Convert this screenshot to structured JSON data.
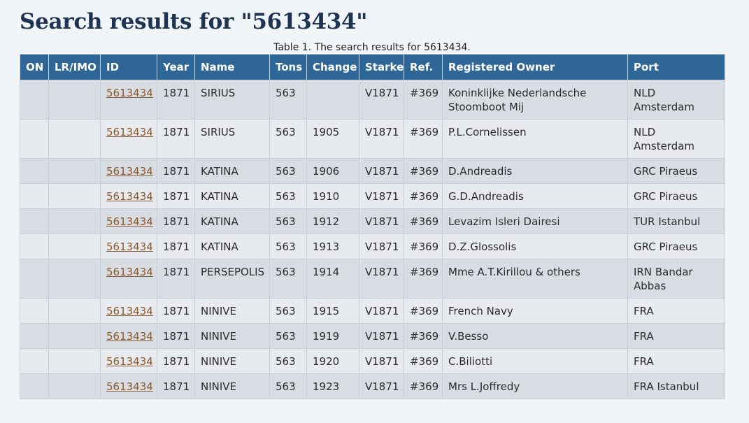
{
  "page": {
    "title": "Search results for \"5613434\"",
    "caption": "Table 1. The search results for 5613434."
  },
  "table": {
    "headers": [
      "ON",
      "LR/IMO",
      "ID",
      "Year",
      "Name",
      "Tons",
      "Change",
      "Starke",
      "Ref.",
      "Registered Owner",
      "Port"
    ],
    "rows": [
      {
        "on": "",
        "lrimo": "",
        "id": "5613434",
        "year": "1871",
        "name": "SIRIUS",
        "tons": "563",
        "change": "",
        "starke": "V1871",
        "ref": "#369",
        "owner": "Koninklijke Nederlandsche Stoomboot Mij",
        "port": "NLD Amsterdam"
      },
      {
        "on": "",
        "lrimo": "",
        "id": "5613434",
        "year": "1871",
        "name": "SIRIUS",
        "tons": "563",
        "change": "1905",
        "starke": "V1871",
        "ref": "#369",
        "owner": "P.L.Cornelissen",
        "port": "NLD Amsterdam"
      },
      {
        "on": "",
        "lrimo": "",
        "id": "5613434",
        "year": "1871",
        "name": "KATINA",
        "tons": "563",
        "change": "1906",
        "starke": "V1871",
        "ref": "#369",
        "owner": "D.Andreadis",
        "port": "GRC Piraeus"
      },
      {
        "on": "",
        "lrimo": "",
        "id": "5613434",
        "year": "1871",
        "name": "KATINA",
        "tons": "563",
        "change": "1910",
        "starke": "V1871",
        "ref": "#369",
        "owner": "G.D.Andreadis",
        "port": "GRC Piraeus"
      },
      {
        "on": "",
        "lrimo": "",
        "id": "5613434",
        "year": "1871",
        "name": "KATINA",
        "tons": "563",
        "change": "1912",
        "starke": "V1871",
        "ref": "#369",
        "owner": "Levazim Isleri Dairesi",
        "port": "TUR Istanbul"
      },
      {
        "on": "",
        "lrimo": "",
        "id": "5613434",
        "year": "1871",
        "name": "KATINA",
        "tons": "563",
        "change": "1913",
        "starke": "V1871",
        "ref": "#369",
        "owner": "D.Z.Glossolis",
        "port": "GRC Piraeus"
      },
      {
        "on": "",
        "lrimo": "",
        "id": "5613434",
        "year": "1871",
        "name": "PERSEPOLIS",
        "tons": "563",
        "change": "1914",
        "starke": "V1871",
        "ref": "#369",
        "owner": "Mme A.T.Kirillou & others",
        "port": "IRN Bandar Abbas"
      },
      {
        "on": "",
        "lrimo": "",
        "id": "5613434",
        "year": "1871",
        "name": "NINIVE",
        "tons": "563",
        "change": "1915",
        "starke": "V1871",
        "ref": "#369",
        "owner": "French Navy",
        "port": "FRA"
      },
      {
        "on": "",
        "lrimo": "",
        "id": "5613434",
        "year": "1871",
        "name": "NINIVE",
        "tons": "563",
        "change": "1919",
        "starke": "V1871",
        "ref": "#369",
        "owner": "V.Besso",
        "port": "FRA"
      },
      {
        "on": "",
        "lrimo": "",
        "id": "5613434",
        "year": "1871",
        "name": "NINIVE",
        "tons": "563",
        "change": "1920",
        "starke": "V1871",
        "ref": "#369",
        "owner": "C.Biliotti",
        "port": "FRA"
      },
      {
        "on": "",
        "lrimo": "",
        "id": "5613434",
        "year": "1871",
        "name": "NINIVE",
        "tons": "563",
        "change": "1923",
        "starke": "V1871",
        "ref": "#369",
        "owner": "Mrs L.Joffredy",
        "port": "FRA Istanbul"
      }
    ]
  },
  "colors": {
    "title": "#1d3553",
    "header_bg": "#2f6698",
    "row_odd": "#d8dde3",
    "row_even": "#e7ebf0",
    "link": "#8a5a2b"
  }
}
